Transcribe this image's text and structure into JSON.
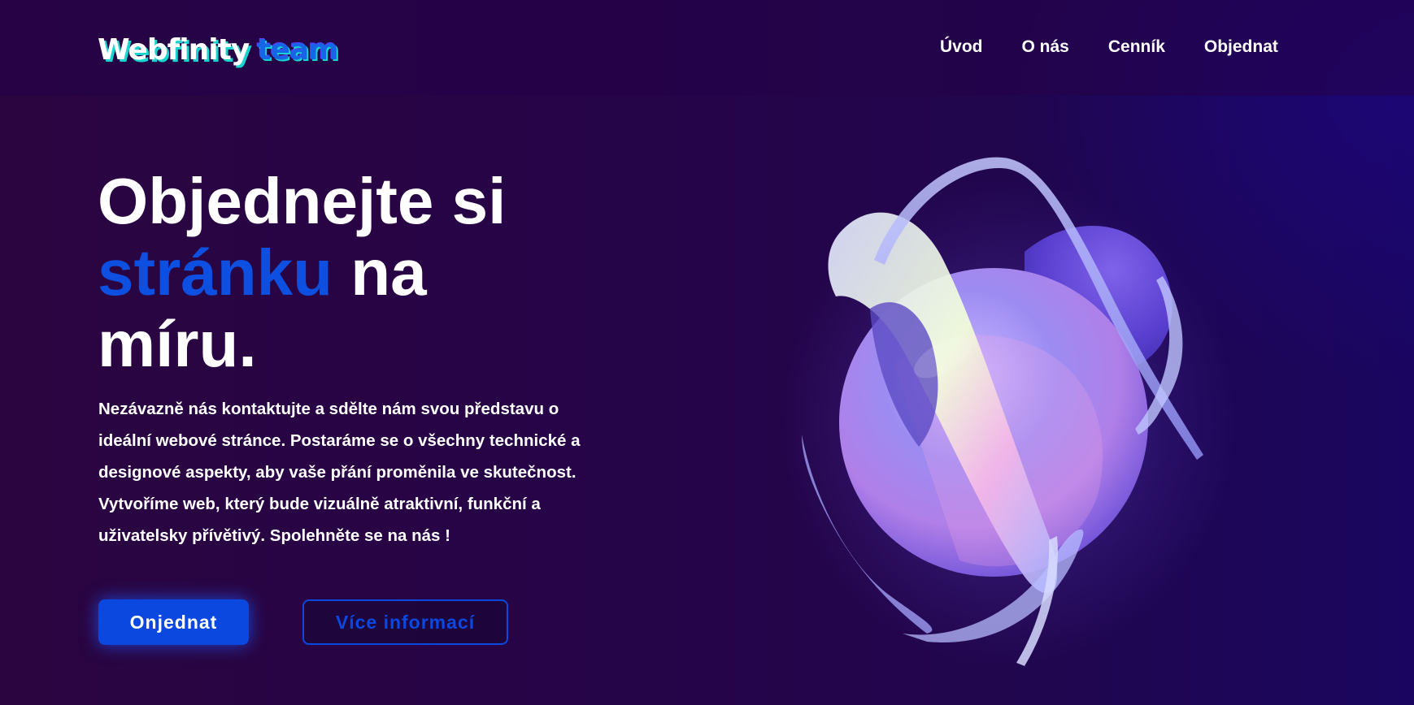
{
  "header": {
    "logo_part1": "Webfinity",
    "logo_part2": "team",
    "nav": [
      {
        "label": "Úvod"
      },
      {
        "label": "O nás"
      },
      {
        "label": "Cenník"
      },
      {
        "label": "Objednat"
      }
    ]
  },
  "hero": {
    "headline_line1": "Objednejte si",
    "headline_accent": "stránku",
    "headline_line2_rest": " na",
    "headline_line3": "míru.",
    "description": "Nezávazně nás kontaktujte a sdělte nám svou představu o ideální webové stránce. Postaráme se o všechny technické a designové aspekty, aby vaše přání proměnila ve skutečnost. Vytvoříme web, který bude vizuálně atraktivní, funkční a uživatelsky přívětivý. Spolehněte se na nás !",
    "primary_button": "Onjednat",
    "secondary_button": "Více informací",
    "illustration_icon": "abstract-sphere-icon"
  },
  "colors": {
    "accent": "#0b48e0",
    "logo_shadow": "#19d3cf",
    "background": "#260448"
  }
}
